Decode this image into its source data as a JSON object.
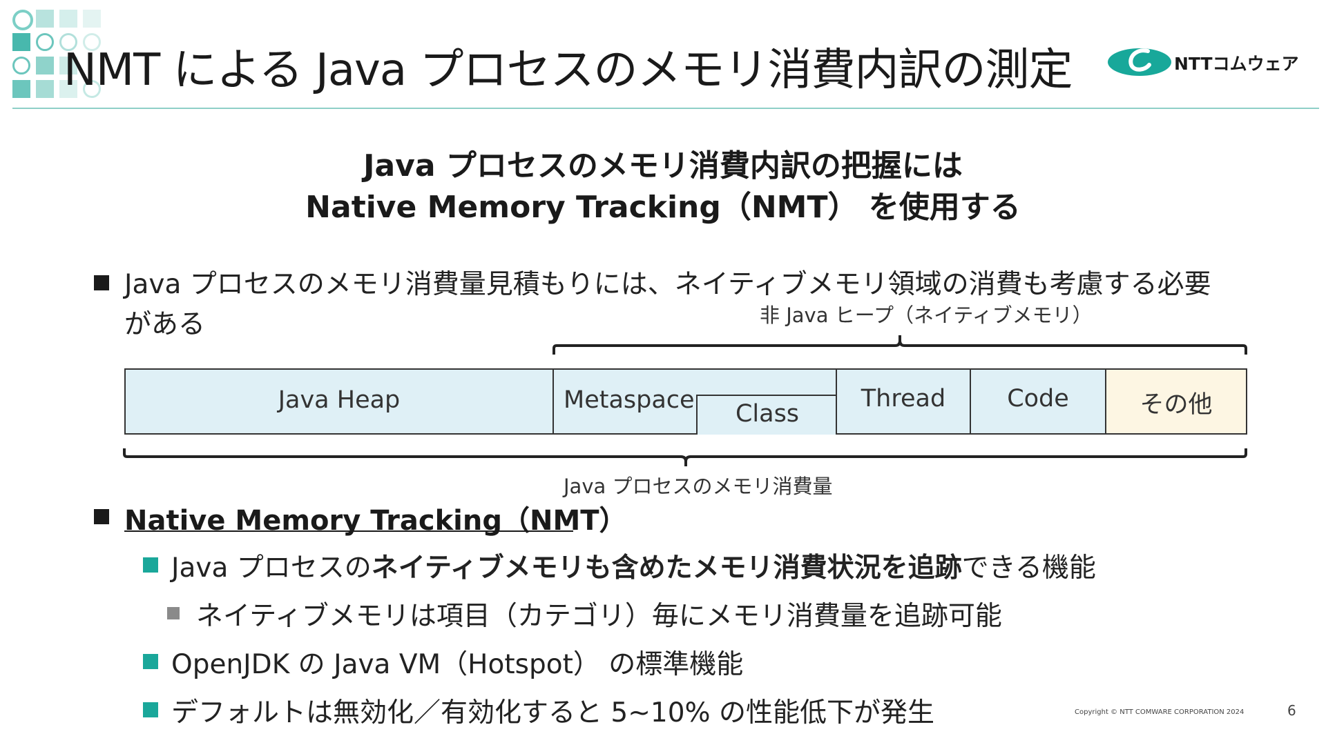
{
  "header": {
    "title": "NMT による Java プロセスのメモリ消費内訳の測定",
    "logo_text": "NTTコムウェア"
  },
  "heading": {
    "line1": "Java プロセスのメモリ消費内訳の把握には",
    "line2": "Native Memory Tracking（NMT） を使用する"
  },
  "bullet1": {
    "line1": "Java プロセスのメモリ消費量見積もりには、ネイティブメモリ領域の消費も考慮する必要",
    "line2": "がある"
  },
  "diagram": {
    "non_heap_label": "非 Java ヒープ（ネイティブメモリ）",
    "process_label": "Java プロセスのメモリ消費量",
    "segments": {
      "java_heap": "Java Heap",
      "metaspace": "Metaspace",
      "class": "Class",
      "thread": "Thread",
      "code": "Code",
      "other": "その他"
    },
    "colors": {
      "native": "#dff0f6",
      "other": "#fdf6e3"
    }
  },
  "bullet2": {
    "title": "Native Memory Tracking（NMT）",
    "sub1": {
      "prefix": "Java プロセスの",
      "bold": "ネイティブメモリも含めたメモリ消費状況を追跡",
      "suffix": "できる機能"
    },
    "sub1_child": "ネイティブメモリは項目（カテゴリ）毎にメモリ消費量を追跡可能",
    "sub2": "OpenJDK の Java VM（Hotspot） の標準機能",
    "sub3": "デフォルトは無効化／有効化すると 5~10% の性能低下が発生"
  },
  "footer": {
    "copyright": "Copyright © NTT COMWARE CORPORATION 2024",
    "page": "6"
  }
}
